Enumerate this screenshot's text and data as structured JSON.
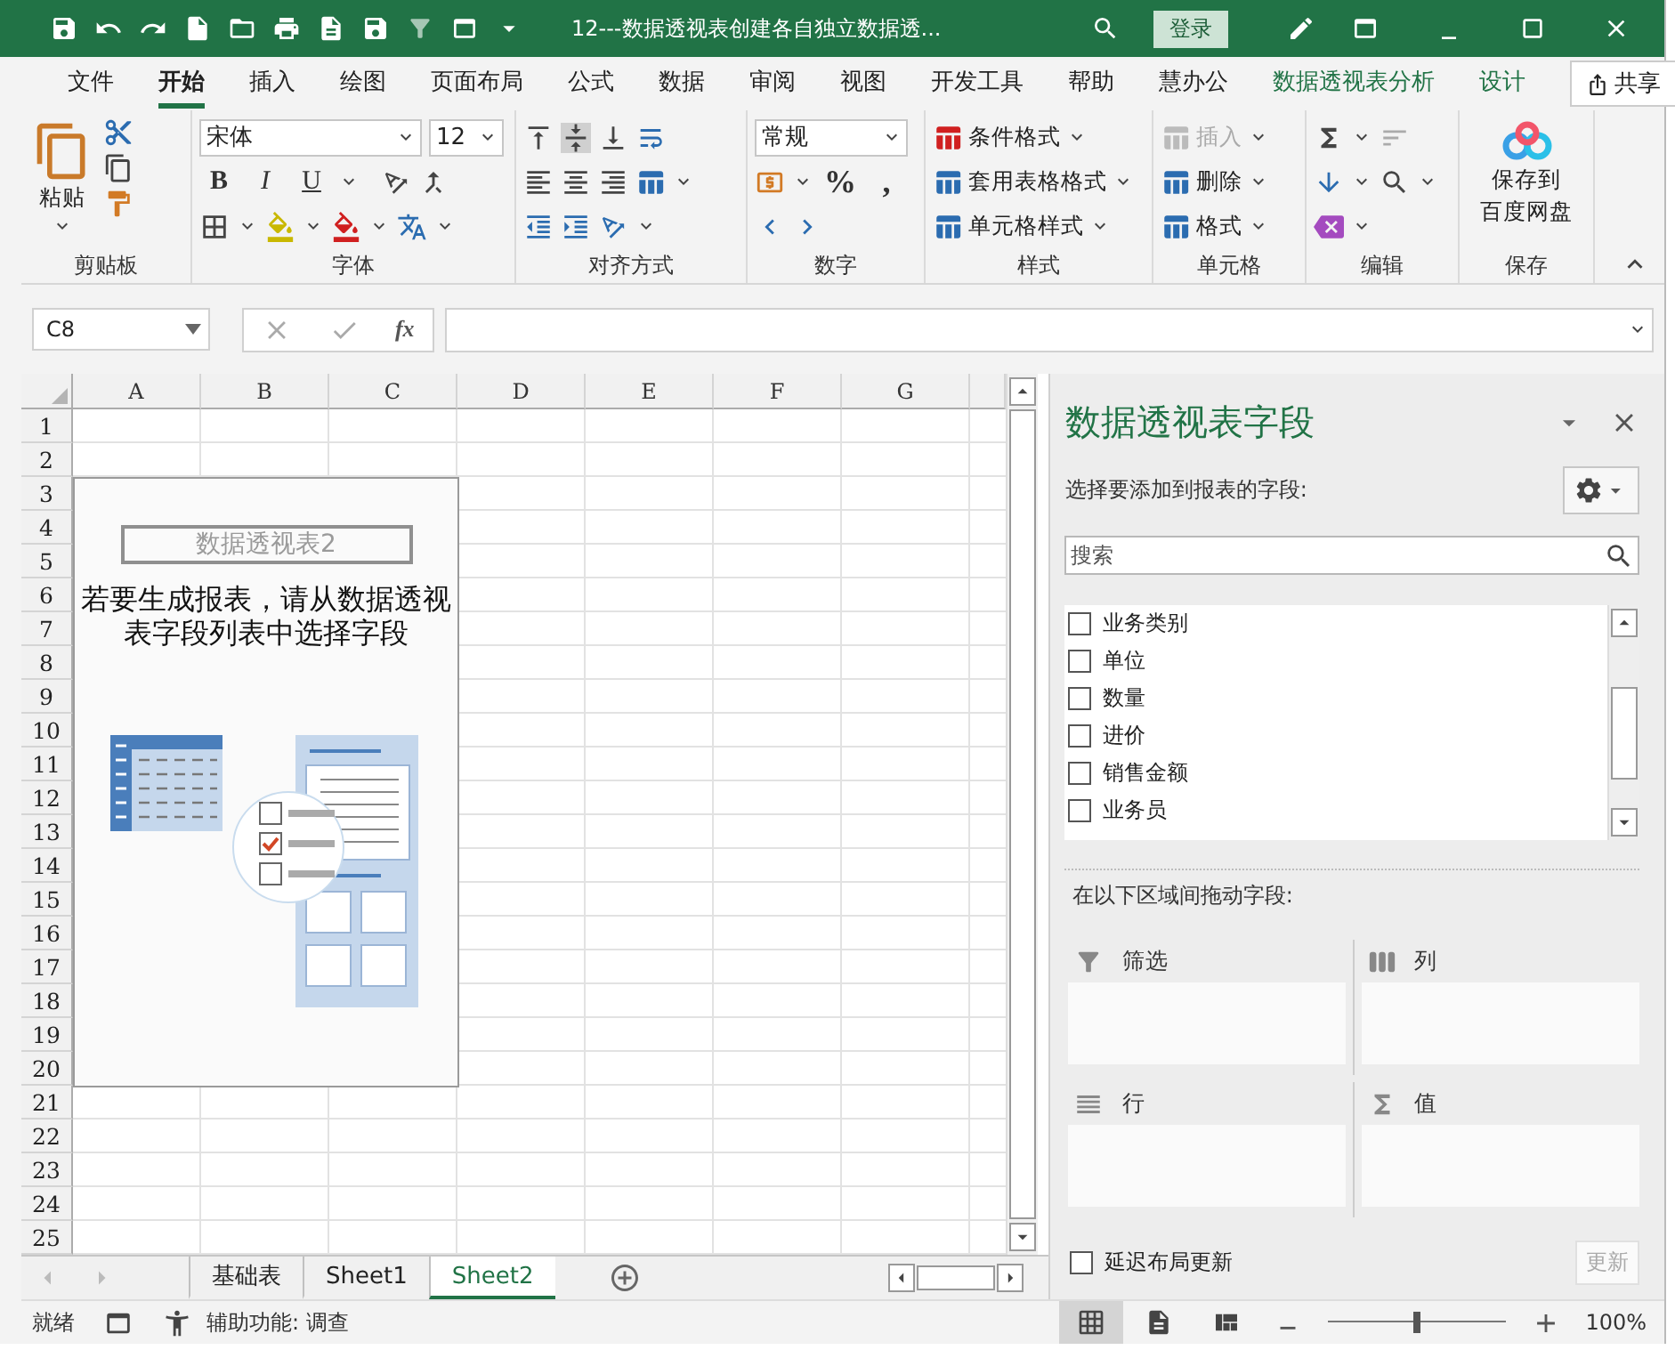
{
  "title_bar": {
    "title": "12---数据透视表创建各自独立数据透...",
    "sign_in": "登录"
  },
  "ribbon_tabs": [
    {
      "label": "文件",
      "selected": false,
      "kind": "standard"
    },
    {
      "label": "开始",
      "selected": true,
      "kind": "standard"
    },
    {
      "label": "插入",
      "selected": false,
      "kind": "standard"
    },
    {
      "label": "绘图",
      "selected": false,
      "kind": "standard"
    },
    {
      "label": "页面布局",
      "selected": false,
      "kind": "standard"
    },
    {
      "label": "公式",
      "selected": false,
      "kind": "standard"
    },
    {
      "label": "数据",
      "selected": false,
      "kind": "standard"
    },
    {
      "label": "审阅",
      "selected": false,
      "kind": "standard"
    },
    {
      "label": "视图",
      "selected": false,
      "kind": "standard"
    },
    {
      "label": "开发工具",
      "selected": false,
      "kind": "standard"
    },
    {
      "label": "帮助",
      "selected": false,
      "kind": "standard"
    },
    {
      "label": "慧办公",
      "selected": false,
      "kind": "standard"
    },
    {
      "label": "数据透视表分析",
      "selected": false,
      "kind": "contextual"
    },
    {
      "label": "设计",
      "selected": false,
      "kind": "contextual"
    }
  ],
  "share_button": "共享",
  "ribbon": {
    "clipboard": {
      "label": "剪贴板",
      "paste": "粘贴"
    },
    "font": {
      "label": "字体",
      "font_name": "宋体",
      "font_size": "12",
      "style_buttons": [
        "B",
        "I",
        "U"
      ]
    },
    "alignment": {
      "label": "对齐方式"
    },
    "number": {
      "label": "数字",
      "format": "常规",
      "symbols": [
        "%",
        ","
      ]
    },
    "styles": {
      "label": "样式",
      "commands": [
        "条件格式",
        "套用表格格式",
        "单元格样式"
      ]
    },
    "cells": {
      "label": "单元格",
      "commands": [
        {
          "label": "插入",
          "disabled": true
        },
        {
          "label": "删除",
          "disabled": false
        },
        {
          "label": "格式",
          "disabled": false
        }
      ]
    },
    "editing": {
      "label": "编辑"
    },
    "save": {
      "label": "保存",
      "button_lines": [
        "保存到",
        "百度网盘"
      ]
    }
  },
  "formula_bar": {
    "name_box": "C8",
    "function_label": "fx"
  },
  "sheet": {
    "columns": [
      "A",
      "B",
      "C",
      "D",
      "E",
      "F",
      "G"
    ],
    "rows": [
      "1",
      "2",
      "3",
      "4",
      "5",
      "6",
      "7",
      "8",
      "9",
      "10",
      "11",
      "12",
      "13",
      "14",
      "15",
      "16",
      "17",
      "18",
      "19",
      "20",
      "21",
      "22",
      "23",
      "24",
      "25"
    ],
    "pivot_placeholder": {
      "title": "数据透视表2",
      "message": "若要生成报表，请从数据透视表字段列表中选择字段"
    }
  },
  "sheet_tabs": [
    {
      "label": "基础表",
      "selected": false
    },
    {
      "label": "Sheet1",
      "selected": false
    },
    {
      "label": "Sheet2",
      "selected": true
    }
  ],
  "pivot_pane": {
    "title": "数据透视表字段",
    "subtitle": "选择要添加到报表的字段:",
    "search": {
      "placeholder": "搜索"
    },
    "fields": [
      {
        "name": "业务类别",
        "checked": false
      },
      {
        "name": "单位",
        "checked": false
      },
      {
        "name": "数量",
        "checked": false
      },
      {
        "name": "进价",
        "checked": false
      },
      {
        "name": "销售金额",
        "checked": false
      },
      {
        "name": "业务员",
        "checked": false
      }
    ],
    "drag_label": "在以下区域间拖动字段:",
    "areas": [
      {
        "label": "筛选",
        "kind": "filter"
      },
      {
        "label": "列",
        "kind": "columns"
      },
      {
        "label": "行",
        "kind": "rows"
      },
      {
        "label": "值",
        "kind": "values"
      }
    ],
    "defer_update": {
      "label": "延迟布局更新",
      "checked": false
    },
    "update_button": {
      "label": "更新",
      "disabled": true
    }
  },
  "status_bar": {
    "status": "就绪",
    "accessibility": "辅助功能: 调查",
    "views": [
      {
        "kind": "normal",
        "selected": true
      },
      {
        "kind": "page_layout",
        "selected": false
      },
      {
        "kind": "page_break",
        "selected": false
      }
    ],
    "zoom": {
      "level": 0.5,
      "reading": "100%"
    }
  }
}
